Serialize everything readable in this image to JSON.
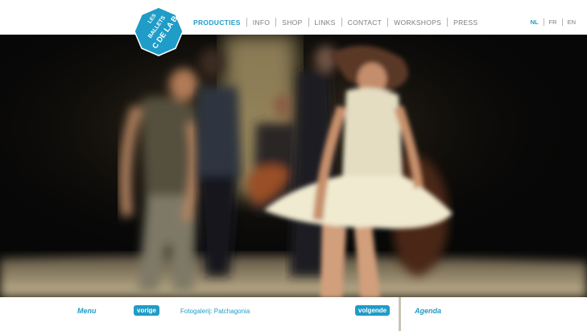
{
  "logo": {
    "text_top": "LES",
    "text_mid": "BALLETS",
    "text_bottom": "C DE LA B"
  },
  "nav": {
    "items": [
      {
        "label": "PRODUCTIES",
        "active": true
      },
      {
        "label": "INFO"
      },
      {
        "label": "SHOP"
      },
      {
        "label": "LINKS"
      },
      {
        "label": "CONTACT"
      },
      {
        "label": "WORKSHOPS"
      },
      {
        "label": "PRESS"
      }
    ]
  },
  "languages": [
    {
      "label": "NL",
      "active": true
    },
    {
      "label": "FR"
    },
    {
      "label": "EN"
    }
  ],
  "hero": {
    "icon": "dance-photo"
  },
  "bottom": {
    "menu_label": "Menu",
    "prev_label": "vorige",
    "gallery_label": "Fotogalerij: Patchagonia",
    "next_label": "volgende",
    "agenda_label": "Agenda"
  },
  "colors": {
    "accent": "#1f9cc7",
    "nav_text": "#7c7c7c",
    "divider": "#c9c5b2"
  }
}
